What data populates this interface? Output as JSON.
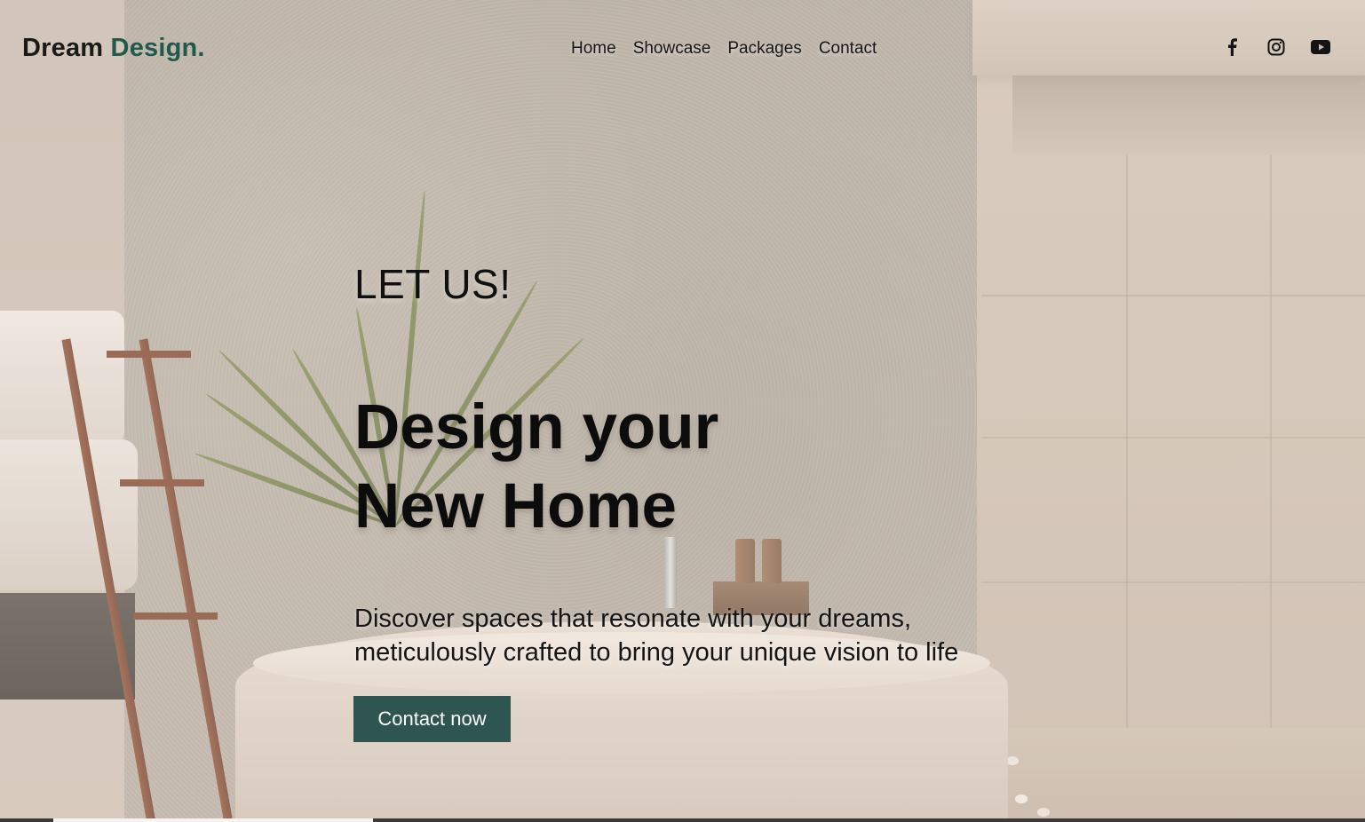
{
  "header": {
    "logo_primary": "Dream",
    "logo_accent": "Design.",
    "nav": [
      {
        "label": "Home"
      },
      {
        "label": "Showcase"
      },
      {
        "label": "Packages"
      },
      {
        "label": "Contact"
      }
    ],
    "social": [
      {
        "icon": "facebook-icon"
      },
      {
        "icon": "instagram-icon"
      },
      {
        "icon": "youtube-icon"
      }
    ]
  },
  "hero": {
    "eyebrow": "LET US!",
    "headline_line1": "Design your",
    "headline_line2": "New Home",
    "subtext_line1": "Discover spaces that resonate with your dreams,",
    "subtext_line2": "meticulously crafted to bring your unique vision to life",
    "cta_label": "Contact now"
  },
  "colors": {
    "accent": "#1f5a4c",
    "button": "#2f5551",
    "text": "#101010"
  }
}
